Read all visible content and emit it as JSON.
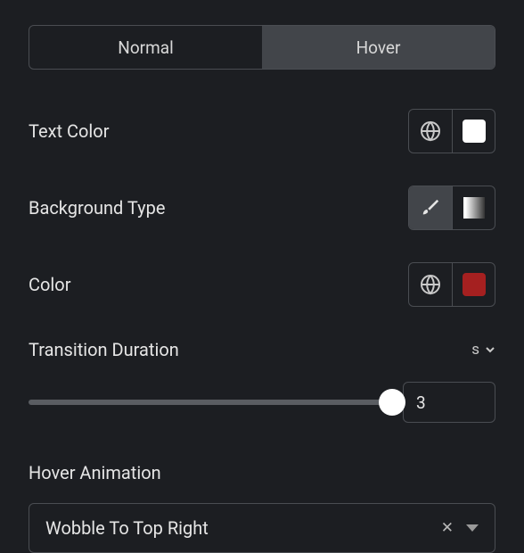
{
  "tabs": {
    "normal": "Normal",
    "hover": "Hover",
    "active": "hover"
  },
  "text_color": {
    "label": "Text Color",
    "swatch": "#ffffff"
  },
  "background_type": {
    "label": "Background Type"
  },
  "color": {
    "label": "Color",
    "swatch": "#a52020"
  },
  "transition": {
    "label": "Transition Duration",
    "unit": "s",
    "value": "3",
    "slider_percent": 100
  },
  "hover_animation": {
    "label": "Hover Animation",
    "value": "Wobble To Top Right"
  }
}
